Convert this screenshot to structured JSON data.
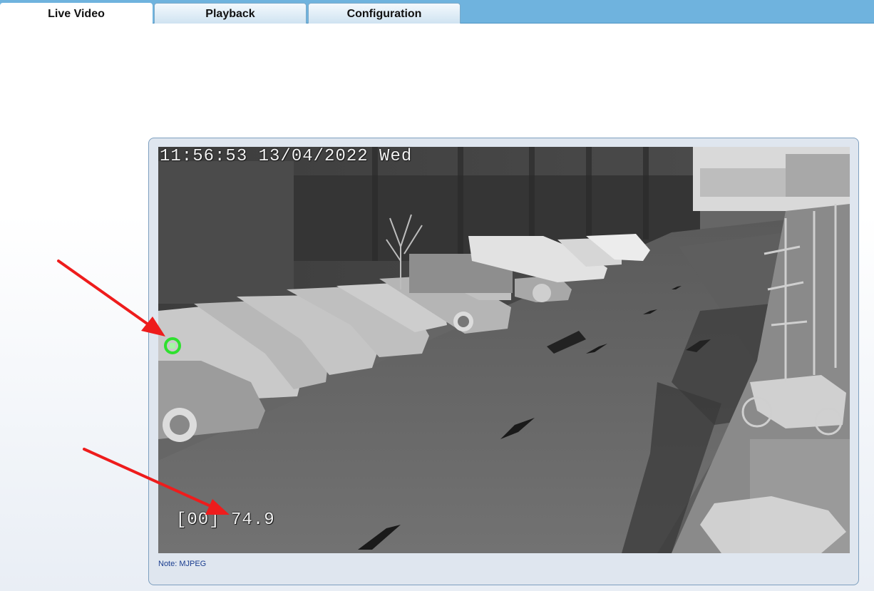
{
  "tabs": [
    {
      "label": "Live Video",
      "active": true
    },
    {
      "label": "Playback",
      "active": false
    },
    {
      "label": "Configuration",
      "active": false
    }
  ],
  "video": {
    "timestamp": "11:56:53 13/04/2022 Wed",
    "temperature_readout": "[00] 74.9",
    "mode": "thermal grayscale",
    "marker_color": "#2fe02f"
  },
  "note": "Note: MJPEG",
  "annotation": {
    "arrow_color": "#ee1c1c"
  }
}
